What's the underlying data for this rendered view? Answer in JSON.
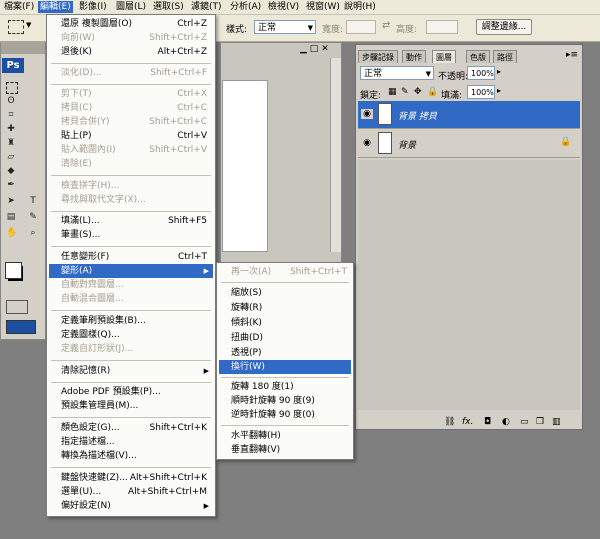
{
  "menubar": {
    "items": [
      {
        "label": "檔案(F)"
      },
      {
        "label": "編輯(E)"
      },
      {
        "label": "影像(I)"
      },
      {
        "label": "圖層(L)"
      },
      {
        "label": "選取(S)"
      },
      {
        "label": "濾鏡(T)"
      },
      {
        "label": "分析(A)"
      },
      {
        "label": "檢視(V)"
      },
      {
        "label": "視窗(W)"
      },
      {
        "label": "說明(H)"
      }
    ]
  },
  "optbar": {
    "style_label": "樣式:",
    "style_value": "正常",
    "width_label": "寬度:",
    "height_label": "高度:",
    "refine_button": "調整邊緣..."
  },
  "toolbox": {
    "logo": "Ps"
  },
  "edit_menu": {
    "items": [
      {
        "label": "還原 複製圖層(O)",
        "shortcut": "Ctrl+Z",
        "disabled": false
      },
      {
        "label": "向前(W)",
        "shortcut": "Shift+Ctrl+Z",
        "disabled": true
      },
      {
        "label": "退後(K)",
        "shortcut": "Alt+Ctrl+Z",
        "disabled": false
      },
      {
        "label": "淡化(D)...",
        "shortcut": "Shift+Ctrl+F",
        "disabled": true
      },
      {
        "label": "剪下(T)",
        "shortcut": "Ctrl+X",
        "disabled": true
      },
      {
        "label": "拷貝(C)",
        "shortcut": "Ctrl+C",
        "disabled": true
      },
      {
        "label": "拷貝合併(Y)",
        "shortcut": "Shift+Ctrl+C",
        "disabled": true
      },
      {
        "label": "貼上(P)",
        "shortcut": "Ctrl+V",
        "disabled": false
      },
      {
        "label": "貼入範圍內(I)",
        "shortcut": "Shift+Ctrl+V",
        "disabled": true
      },
      {
        "label": "清除(E)",
        "shortcut": "",
        "disabled": true
      },
      {
        "label": "檢查拼字(H)...",
        "shortcut": "",
        "disabled": true
      },
      {
        "label": "尋找與取代文字(X)...",
        "shortcut": "",
        "disabled": true
      },
      {
        "label": "填滿(L)...",
        "shortcut": "Shift+F5",
        "disabled": false
      },
      {
        "label": "筆畫(S)...",
        "shortcut": "",
        "disabled": false
      },
      {
        "label": "任意變形(F)",
        "shortcut": "Ctrl+T",
        "disabled": false
      },
      {
        "label": "變形(A)",
        "shortcut": "",
        "disabled": false
      },
      {
        "label": "自動對齊圖層...",
        "shortcut": "",
        "disabled": true
      },
      {
        "label": "自動混合圖層...",
        "shortcut": "",
        "disabled": true
      },
      {
        "label": "定義筆刷預設集(B)...",
        "shortcut": "",
        "disabled": false
      },
      {
        "label": "定義圖樣(Q)...",
        "shortcut": "",
        "disabled": false
      },
      {
        "label": "定義自訂形狀(J)...",
        "shortcut": "",
        "disabled": true
      },
      {
        "label": "清除記憶(R)",
        "shortcut": "",
        "disabled": false
      },
      {
        "label": "Adobe PDF 預設集(P)...",
        "shortcut": "",
        "disabled": false
      },
      {
        "label": "預設集管理員(M)...",
        "shortcut": "",
        "disabled": false
      },
      {
        "label": "顏色設定(G)...",
        "shortcut": "Shift+Ctrl+K",
        "disabled": false
      },
      {
        "label": "指定描述檔...",
        "shortcut": "",
        "disabled": false
      },
      {
        "label": "轉換為描述檔(V)...",
        "shortcut": "",
        "disabled": false
      },
      {
        "label": "鍵盤快速鍵(Z)...",
        "shortcut": "Alt+Shift+Ctrl+K",
        "disabled": false
      },
      {
        "label": "選單(U)...",
        "shortcut": "Alt+Shift+Ctrl+M",
        "disabled": false
      },
      {
        "label": "偏好設定(N)",
        "shortcut": "",
        "disabled": false
      }
    ]
  },
  "transform_menu": {
    "items": [
      {
        "label": "再一次(A)",
        "shortcut": "Shift+Ctrl+T",
        "disabled": true
      },
      {
        "label": "縮放(S)",
        "shortcut": "",
        "disabled": false
      },
      {
        "label": "旋轉(R)",
        "shortcut": "",
        "disabled": false
      },
      {
        "label": "傾斜(K)",
        "shortcut": "",
        "disabled": false
      },
      {
        "label": "扭曲(D)",
        "shortcut": "",
        "disabled": false
      },
      {
        "label": "透視(P)",
        "shortcut": "",
        "disabled": false
      },
      {
        "label": "換行(W)",
        "shortcut": "",
        "disabled": false
      },
      {
        "label": "旋轉 180 度(1)",
        "shortcut": "",
        "disabled": false
      },
      {
        "label": "順時針旋轉 90 度(9)",
        "shortcut": "",
        "disabled": false
      },
      {
        "label": "逆時針旋轉 90 度(0)",
        "shortcut": "",
        "disabled": false
      },
      {
        "label": "水平翻轉(H)",
        "shortcut": "",
        "disabled": false
      },
      {
        "label": "垂直翻轉(V)",
        "shortcut": "",
        "disabled": false
      }
    ]
  },
  "layers_panel": {
    "tabs": [
      {
        "label": "步驟記錄"
      },
      {
        "label": "動作"
      },
      {
        "label": "圖層"
      },
      {
        "label": "色版"
      },
      {
        "label": "路徑"
      }
    ],
    "blend_mode": "正常",
    "opacity_label": "不透明:",
    "opacity_value": "100%",
    "lock_label": "鎖定:",
    "fill_label": "填滿:",
    "fill_value": "100%",
    "layers": [
      {
        "name": "背景 拷貝",
        "selected": true
      },
      {
        "name": "背景",
        "selected": false
      }
    ],
    "footer_icons": [
      "link-icon",
      "fx-icon",
      "mask-icon",
      "adjustment-icon",
      "folder-icon",
      "new-layer-icon",
      "trash-icon"
    ]
  },
  "colors": {
    "selection": "#316ac5",
    "menubar": "#ece9d8"
  }
}
